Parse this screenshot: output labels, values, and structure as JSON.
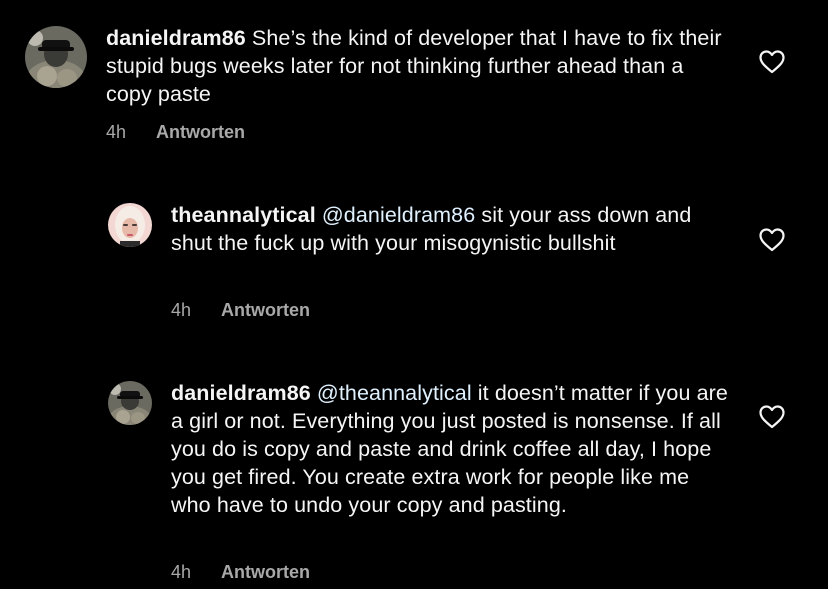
{
  "comments": [
    {
      "username": "danieldram86",
      "mention": "",
      "text": " She’s the kind of developer that I have to fix their stupid bugs weeks later for not thinking further ahead than a copy paste",
      "time": "4h",
      "reply_label": "Antworten",
      "avatar_icon": "profile-photo-dark",
      "heart_icon": "heart-outline-icon"
    },
    {
      "username": "theannalytical",
      "mention": " @danieldram86",
      "text": " sit your ass down and shut the fuck up with your misogynistic bullshit",
      "time": "4h",
      "reply_label": "Antworten",
      "avatar_icon": "profile-photo-light",
      "heart_icon": "heart-outline-icon"
    },
    {
      "username": "danieldram86",
      "mention": " @theannalytical",
      "text": " it doesn’t matter if you are a girl or not. Everything you just posted is nonsense. If all you do is copy and paste and drink coffee all day, I hope you get fired. You create extra work for people like me who have to undo your copy and pasting.",
      "time": "4h",
      "reply_label": "Antworten",
      "avatar_icon": "profile-photo-dark",
      "heart_icon": "heart-outline-icon"
    }
  ],
  "colors": {
    "background": "#000000",
    "text": "#f5f5f5",
    "mention": "#e0f1ff",
    "meta": "#a8a8a8"
  }
}
